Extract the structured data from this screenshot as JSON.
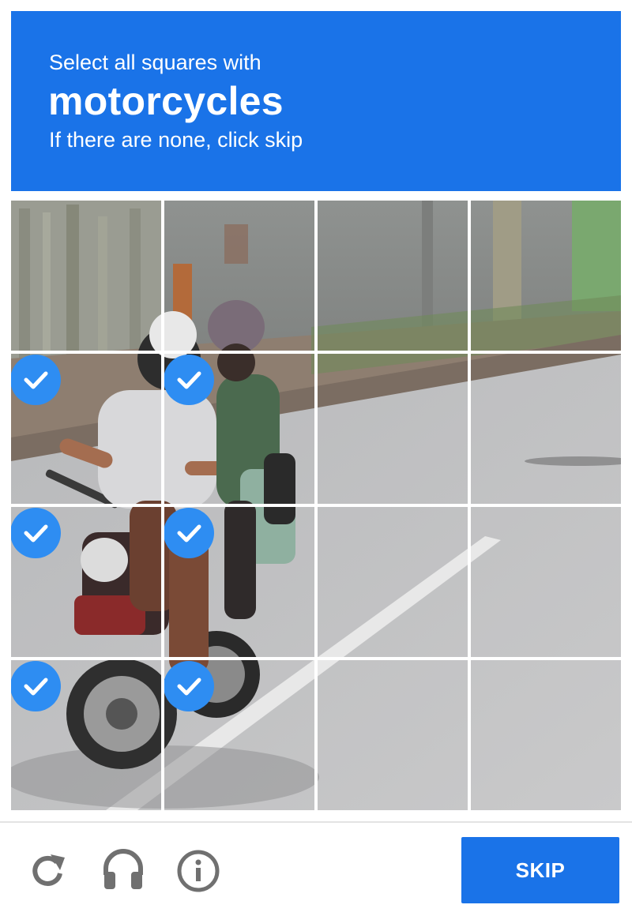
{
  "header": {
    "instruction": "Select all squares with",
    "keyword": "motorcycles",
    "hint": "If there are none, click skip"
  },
  "grid": {
    "rows": 4,
    "columns": 4,
    "selected_tiles": [
      [
        1,
        0
      ],
      [
        1,
        1
      ],
      [
        2,
        0
      ],
      [
        2,
        1
      ],
      [
        3,
        0
      ],
      [
        3,
        1
      ]
    ]
  },
  "footer": {
    "reload_icon": "reload-icon",
    "audio_icon": "headphones-icon",
    "info_icon": "info-icon",
    "skip_label": "SKIP"
  },
  "colors": {
    "accent": "#1a73e8",
    "check_badge": "#2e8df2",
    "icon_gray": "#707070"
  }
}
